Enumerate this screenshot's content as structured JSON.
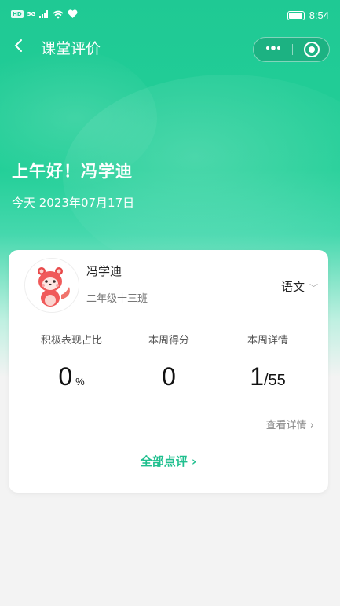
{
  "status_bar": {
    "network_badge": "HD",
    "signal_label": "5G",
    "time": "8:54",
    "icons": [
      "signal-icon",
      "wifi-icon",
      "heart-icon",
      "battery-icon"
    ]
  },
  "nav": {
    "title": "课堂评价",
    "back_icon": "chevron-left-icon",
    "more_icon": "more-dots-icon",
    "close_icon": "target-close-icon"
  },
  "hero": {
    "greeting": "上午好！冯学迪",
    "date": "今天 2023年07月17日"
  },
  "student": {
    "name": "冯学迪",
    "class_name": "二年级十三班",
    "subject": "语文",
    "avatar": "red-panda-avatar"
  },
  "stats": [
    {
      "label": "积极表现占比",
      "value": "0",
      "unit": "%"
    },
    {
      "label": "本周得分",
      "value": "0"
    },
    {
      "label": "本周详情",
      "value": "1",
      "total": "/55"
    }
  ],
  "links": {
    "view_details": "查看详情",
    "all_reviews": "全部点评"
  },
  "colors": {
    "accent": "#1fc994",
    "link": "#1fbf8e"
  }
}
